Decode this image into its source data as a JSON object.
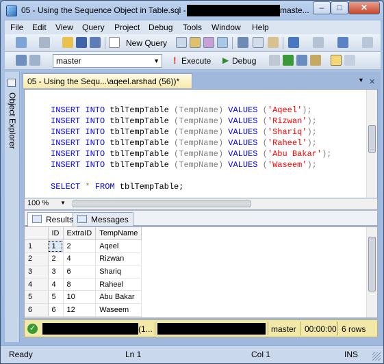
{
  "window": {
    "title": "05 - Using the Sequence Object in Table.sql -",
    "title_suffix": "maste...",
    "min": "–",
    "max": "□",
    "close": "✕"
  },
  "menu": [
    "File",
    "Edit",
    "View",
    "Query",
    "Project",
    "Debug",
    "Tools",
    "Window",
    "Help"
  ],
  "toolbar1": {
    "new_query": "New Query"
  },
  "toolbar2": {
    "database": "master",
    "execute": "Execute",
    "debug": "Debug"
  },
  "sidebar": {
    "label": "Object Explorer"
  },
  "tab": {
    "title": "05 - Using the Sequ...\\aqeel.arshad (56))*",
    "close": "✕"
  },
  "editor": {
    "inserts": [
      {
        "kw1": "INSERT INTO",
        "table": " tblTempTable ",
        "col": "(TempName)",
        "kw2": " VALUES ",
        "val": "'Aqeel'",
        "end": ");"
      },
      {
        "kw1": "INSERT INTO",
        "table": " tblTempTable ",
        "col": "(TempName)",
        "kw2": " VALUES ",
        "val": "'Rizwan'",
        "end": ");"
      },
      {
        "kw1": "INSERT INTO",
        "table": " tblTempTable ",
        "col": "(TempName)",
        "kw2": " VALUES ",
        "val": "'Shariq'",
        "end": ");"
      },
      {
        "kw1": "INSERT INTO",
        "table": " tblTempTable ",
        "col": "(TempName)",
        "kw2": " VALUES ",
        "val": "'Raheel'",
        "end": ");"
      },
      {
        "kw1": "INSERT INTO",
        "table": " tblTempTable ",
        "col": "(TempName)",
        "kw2": " VALUES ",
        "val": "'Abu Bakar'",
        "end": ");"
      },
      {
        "kw1": "INSERT INTO",
        "table": " tblTempTable ",
        "col": "(TempName)",
        "kw2": " VALUES ",
        "val": "'Waseem'",
        "end": ");"
      }
    ],
    "select": {
      "kw1": "SELECT",
      "star": " * ",
      "kw2": "FROM",
      "rest": " tblTempTable;"
    }
  },
  "zoom": "100 %",
  "results_tabs": {
    "results": "Results",
    "messages": "Messages"
  },
  "grid": {
    "columns": [
      "",
      "ID",
      "ExtraID",
      "TempName"
    ],
    "rows": [
      [
        "1",
        "1",
        "2",
        "Aqeel"
      ],
      [
        "2",
        "2",
        "4",
        "Rizwan"
      ],
      [
        "3",
        "3",
        "6",
        "Shariq"
      ],
      [
        "4",
        "4",
        "8",
        "Raheel"
      ],
      [
        "5",
        "5",
        "10",
        "Abu Bakar"
      ],
      [
        "6",
        "6",
        "12",
        "Waseem"
      ]
    ]
  },
  "exec_status": {
    "server_frag": "(1...",
    "db": "master",
    "time": "00:00:00",
    "rows": "6 rows",
    "ok": "✓"
  },
  "status": {
    "ready": "Ready",
    "ln": "Ln 1",
    "col": "Col 1",
    "ins": "INS"
  }
}
